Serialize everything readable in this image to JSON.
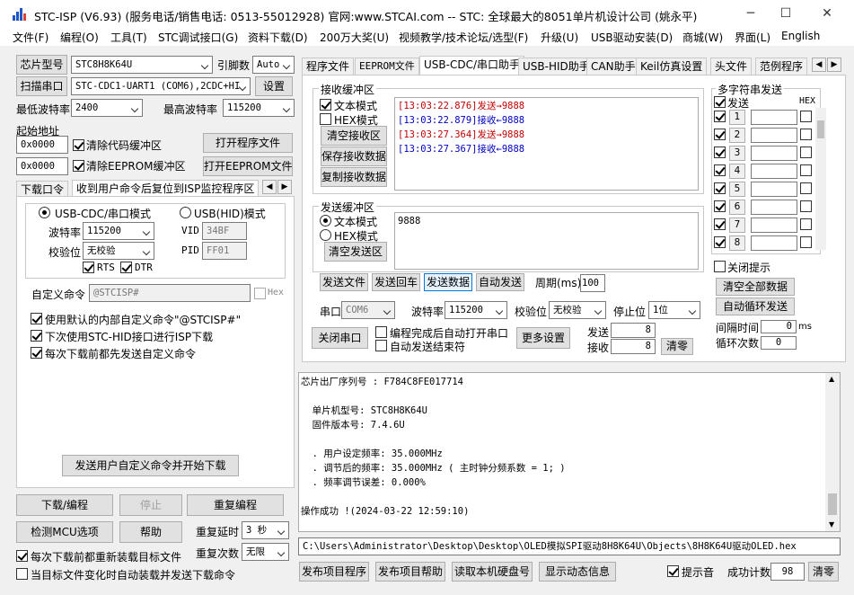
{
  "window": {
    "title": "STC-ISP (V6.93) (服务电话/销售电话: 0513-55012928) 官网:www.STCAI.com  -- STC: 全球最大的8051单片机设计公司 (姚永平)",
    "minimize": "─",
    "maximize": "☐",
    "close": "✕"
  },
  "menu": [
    "文件(F)",
    "编程(O)",
    "工具(T)",
    "STC调试接口(G)",
    "资料下载(D)",
    "200万大奖(U)",
    "视频教学/技术论坛/选型(F)",
    "升级(U)",
    "USB驱动安装(D)",
    "商城(W)",
    "界面(L)",
    "English"
  ],
  "left": {
    "chip_model_btn": "芯片型号",
    "chip_model": "STC8H8K64U",
    "pin_label": "引脚数",
    "pin_value": "Auto",
    "scan_btn": "扫描串口",
    "port_value": "STC-CDC1-UART1 (COM6),2CDC+HI",
    "settings_btn": "设置",
    "min_baud_label": "最低波特率",
    "min_baud": "2400",
    "max_baud_label": "最高波特率",
    "max_baud": "115200",
    "start_addr_label": "起始地址",
    "code_addr": "0x0000",
    "clear_code": "清除代码缓冲区",
    "open_prog_btn": "打开程序文件",
    "eeprom_addr": "0x0000",
    "clear_eeprom": "清除EEPROM缓冲区",
    "open_eeprom_btn": "打开EEPROM文件",
    "tabs": [
      "下载口令",
      "收到用户命令后复位到ISP监控程序区"
    ],
    "usb_cdc_mode": "USB-CDC/串口模式",
    "usb_hid_mode": "USB(HID)模式",
    "baud_label": "波特率",
    "baud_value": "115200",
    "parity_label": "校验位",
    "parity_value": "无校验",
    "vid_label": "VID",
    "vid_value": "34BF",
    "pid_label": "PID",
    "pid_value": "FF01",
    "rts": "RTS",
    "dtr": "DTR",
    "custom_cmd_label": "自定义命令",
    "custom_cmd_value": "@STCISP#",
    "hex": "Hex",
    "opt1": "使用默认的内部自定义命令\"@STCISP#\"",
    "opt2": "下次使用STC-HID接口进行ISP下载",
    "opt3": "每次下载前都先发送自定义命令",
    "send_custom_btn": "发送用户自定义命令并开始下载",
    "download_btn": "下载/编程",
    "stop_btn": "停止",
    "reprog_btn": "重复编程",
    "check_mcu_btn": "检测MCU选项",
    "help_btn": "帮助",
    "repeat_delay_label": "重复延时",
    "repeat_delay_value": "3 秒",
    "repeat_count_label": "重复次数",
    "repeat_count_value": "无限",
    "reload_before": "每次下载前都重新装载目标文件",
    "auto_load": "当目标文件变化时自动装载并发送下载命令"
  },
  "right": {
    "tabs": [
      "程序文件",
      "EEPROM文件",
      "USB-CDC/串口助手",
      "USB-HID助手",
      "CAN助手",
      "Keil仿真设置",
      "头文件",
      "范例程序"
    ],
    "recv_title": "接收缓冲区",
    "text_mode": "文本模式",
    "hex_mode": "HEX模式",
    "clear_recv": "清空接收区",
    "save_recv": "保存接收数据",
    "copy_recv": "复制接收数据",
    "recv_lines": [
      {
        "ts": "[13:03:22.876]",
        "msg": "发送→9888",
        "color": "#c00000"
      },
      {
        "ts": "[13:03:22.879]",
        "msg": "接收←9888",
        "color": "#0000c0"
      },
      {
        "ts": "[13:03:27.364]",
        "msg": "发送→9888",
        "color": "#c00000"
      },
      {
        "ts": "[13:03:27.367]",
        "msg": "接收←9888",
        "color": "#0000c0"
      }
    ],
    "send_title": "发送缓冲区",
    "send_text_mode": "文本模式",
    "send_hex_mode": "HEX模式",
    "clear_send": "清空发送区",
    "send_content": "9888",
    "send_file": "发送文件",
    "send_return": "发送回车",
    "send_data": "发送数据",
    "auto_send": "自动发送",
    "period_label": "周期(ms)",
    "period_value": "100",
    "port_label": "串口",
    "port_value": "COM6",
    "baud_label": "波特率",
    "baud_value": "115200",
    "parity_label": "校验位",
    "parity_value": "无校验",
    "stop_label": "停止位",
    "stop_value": "1位",
    "close_port": "关闭串口",
    "auto_open": "编程完成后自动打开串口",
    "auto_end": "自动发送结束符",
    "more_settings": "更多设置",
    "send_count_label": "发送",
    "send_count": "8",
    "recv_count_label": "接收",
    "recv_count": "8",
    "clear_count": "清零",
    "multi_title": "多字符串发送",
    "multi_send": "发送",
    "multi_hex": "HEX",
    "multi_items": [
      "1",
      "2",
      "3",
      "4",
      "5",
      "6",
      "7",
      "8"
    ],
    "close_tip": "关闭提示",
    "clear_all": "清空全部数据",
    "auto_loop": "自动循环发送",
    "interval_label": "间隔时间",
    "interval_value": "0",
    "interval_unit": "ms",
    "loop_count_label": "循环次数",
    "loop_count_value": "0",
    "log_lines": [
      "芯片出厂序列号 : F784C8FE017714",
      "",
      "  单片机型号: STC8H8K64U",
      "  固件版本号: 7.4.6U",
      "",
      "  . 用户设定频率: 35.000MHz",
      "  . 调节后的频率: 35.000MHz ( 主时钟分频系数 = 1; )",
      "  . 频率调节误差: 0.000%",
      "",
      "操作成功 !(2024-03-22 12:59:10)"
    ],
    "path": "C:\\Users\\Administrator\\Desktop\\Desktop\\OLED模拟SPI驱动8H8K64U\\Objects\\8H8K64U驱动OLED.hex",
    "publish_prog": "发布项目程序",
    "publish_help": "发布项目帮助",
    "read_disk": "读取本机硬盘号",
    "show_dyn": "显示动态信息",
    "beep": "提示音",
    "success_label": "成功计数",
    "success_count": "98",
    "clear": "清零"
  }
}
